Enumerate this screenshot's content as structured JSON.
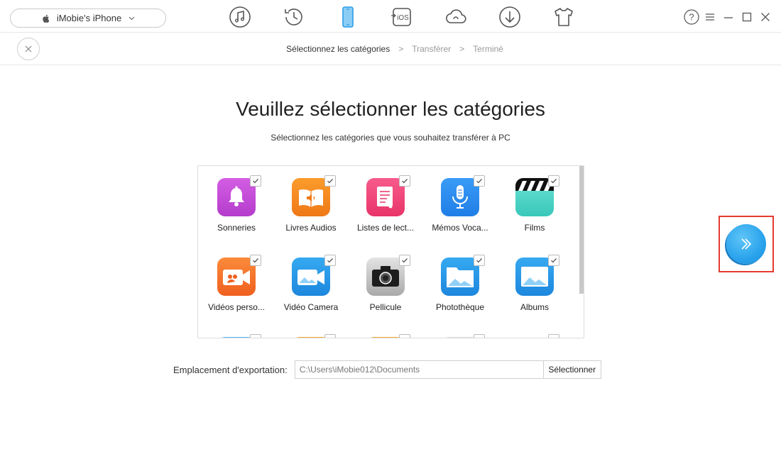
{
  "device": {
    "name": "iMobie's iPhone"
  },
  "nav": {
    "items": [
      {
        "icon": "music-icon"
      },
      {
        "icon": "history-icon"
      },
      {
        "icon": "phone-icon",
        "active": true
      },
      {
        "icon": "to-ios-icon",
        "label": "iOS"
      },
      {
        "icon": "cloud-icon"
      },
      {
        "icon": "download-icon"
      },
      {
        "icon": "tshirt-icon"
      }
    ]
  },
  "window": {
    "help": "?"
  },
  "steps": [
    {
      "label": "Sélectionnez les catégories",
      "active": true
    },
    {
      "label": "Transférer",
      "active": false
    },
    {
      "label": "Terminé",
      "active": false
    }
  ],
  "steps_sep": ">",
  "main": {
    "title": "Veuillez sélectionner les catégories",
    "subtitle": "Sélectionnez les catégories que vous souhaitez transférer à PC"
  },
  "categories": [
    {
      "label": "Sonneries",
      "icon": "bell-icon",
      "color": "#c548d8",
      "checked": true
    },
    {
      "label": "Livres Audios",
      "icon": "audiobook-icon",
      "color": "#f58a1f",
      "checked": true
    },
    {
      "label": "Listes de lect...",
      "icon": "playlist-icon",
      "color": "#f0447a",
      "checked": true
    },
    {
      "label": "Mémos Voca...",
      "icon": "microphone-icon",
      "color": "#2e8ff0",
      "checked": true
    },
    {
      "label": "Films",
      "icon": "clapperboard-icon",
      "color": "#4fd6c8",
      "checked": true
    },
    {
      "label": "Vidéos perso...",
      "icon": "video-camera-icon",
      "color": "#f5732a",
      "checked": true
    },
    {
      "label": "Vidéo Camera",
      "icon": "video-camera-icon",
      "color": "#2a9de8",
      "checked": true
    },
    {
      "label": "Pellicule",
      "icon": "camera-icon",
      "color": "#b9b9b9",
      "checked": true
    },
    {
      "label": "Photothèque",
      "icon": "photo-folder-icon",
      "color": "#2a9de8",
      "checked": true
    },
    {
      "label": "Albums",
      "icon": "album-icon",
      "color": "#2a9de8",
      "checked": true
    }
  ],
  "export": {
    "label": "Emplacement d'exportation:",
    "path": "C:\\Users\\iMobie012\\Documents",
    "button": "Sélectionner"
  },
  "colors": {
    "accent": "#2aa3ec",
    "highlight_border": "#e53a2f"
  }
}
